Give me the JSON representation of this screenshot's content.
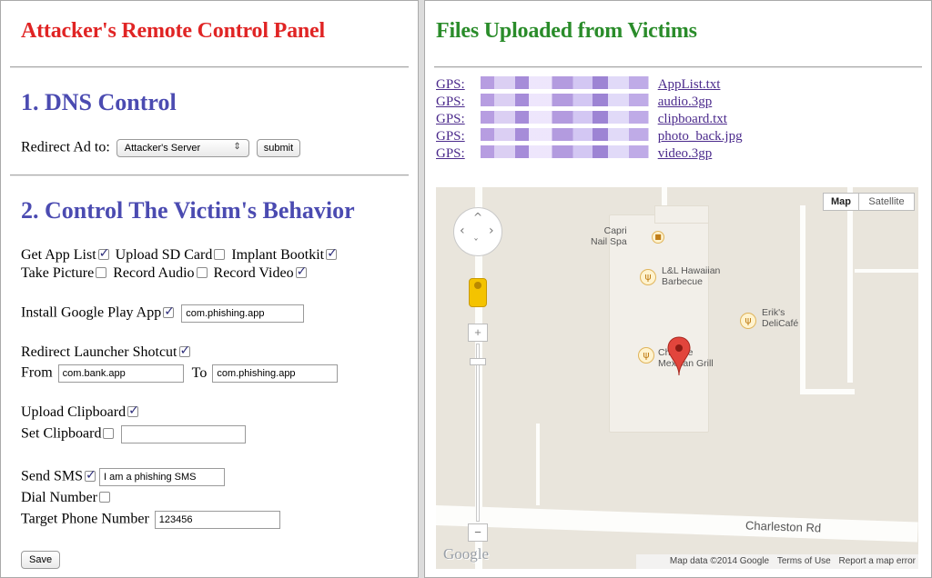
{
  "left": {
    "title": "Attacker's Remote Control Panel",
    "section1": {
      "heading": "1. DNS Control",
      "label": "Redirect Ad to:",
      "select_value": "Attacker's Server",
      "submit": "submit"
    },
    "section2": {
      "heading": "2. Control The Victim's Behavior",
      "row1": [
        {
          "label": "Get App List",
          "checked": true
        },
        {
          "label": "Upload SD Card",
          "checked": true
        },
        {
          "label": "Implant Bootkit",
          "checked": false,
          "trail_checked": true
        }
      ],
      "get_app_list": "Get App List",
      "upload_sd": "Upload SD Card",
      "implant_bootkit": "Implant Bootkit",
      "take_picture": "Take Picture",
      "record_audio": "Record Audio",
      "record_video": "Record Video",
      "install_gp": "Install Google Play App",
      "install_gp_value": "com.phishing.app",
      "redirect_launcher": "Redirect Launcher Shotcut",
      "from_label": "From",
      "from_value": "com.bank.app",
      "to_label": "To",
      "to_value": "com.phishing.app",
      "upload_clipboard": "Upload Clipboard",
      "set_clipboard": "Set Clipboard",
      "set_clipboard_value": "",
      "send_sms": "Send SMS",
      "send_sms_value": "I am a phishing SMS",
      "dial_number": "Dial Number",
      "target_phone": "Target Phone Number",
      "target_phone_value": "123456",
      "save": "Save"
    }
  },
  "right": {
    "title": "Files Uploaded from Victims",
    "files": [
      {
        "prefix": "GPS:",
        "name": "AppList.txt"
      },
      {
        "prefix": "GPS:",
        "name": "audio.3gp"
      },
      {
        "prefix": "GPS:",
        "name": "clipboard.txt"
      },
      {
        "prefix": "GPS:",
        "name": "photo_back.jpg"
      },
      {
        "prefix": "GPS:",
        "name": "video.3gp"
      }
    ],
    "map": {
      "type_map": "Map",
      "type_satellite": "Satellite",
      "poi_capri": "Capri\nNail Spa",
      "poi_capri_1": "Capri",
      "poi_capri_2": "Nail Spa",
      "poi_hawaiian_1": "L&L Hawaiian",
      "poi_hawaiian_2": "Barbecue",
      "poi_eriks_1": "Erik's",
      "poi_eriks_2": "DeliCafé",
      "poi_chipotle_1": "Chipotle",
      "poi_chipotle_2": "Mexican Grill",
      "road": "Charleston Rd",
      "logo": "Google",
      "attribution": "Map data ©2014 Google",
      "terms": "Terms of Use",
      "report": "Report a map error",
      "zoom_in": "+",
      "zoom_out": "−"
    }
  },
  "colors": {
    "title_left": "#e02424",
    "title_right": "#2a8c2a",
    "heading": "#4b4bb1",
    "link": "#4b2a8c"
  }
}
